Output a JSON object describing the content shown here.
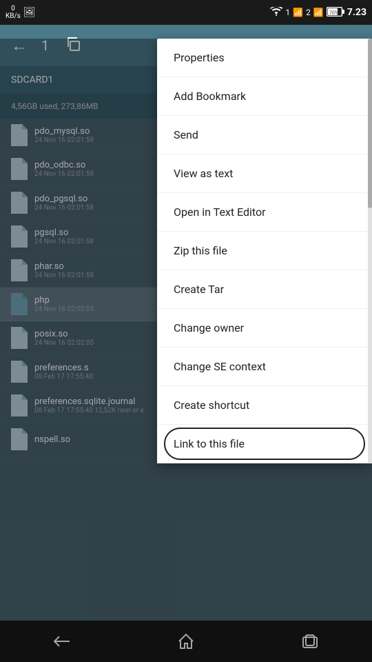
{
  "statusBar": {
    "kb": "0",
    "kb_label": "KB/s",
    "time": "7.23",
    "battery": "70%",
    "network1": "1",
    "network2": "2"
  },
  "toolbar": {
    "back_label": "←",
    "count": "1"
  },
  "breadcrumb": {
    "path": "SDCARD1"
  },
  "usage": {
    "text": "4,56GB used, 273,86MB"
  },
  "files": [
    {
      "name": "pdo_mysql.so",
      "meta": "24 Nov 16 02:01:58"
    },
    {
      "name": "pdo_odbc.so",
      "meta": "24 Nov 16 02:01:58"
    },
    {
      "name": "pdo_pgsql.so",
      "meta": "24 Nov 16 02:01:58"
    },
    {
      "name": "pgsql.so",
      "meta": "24 Nov 16 02:01:58"
    },
    {
      "name": "phar.so",
      "meta": "24 Nov 16 02:01:58"
    },
    {
      "name": "php",
      "meta": "24 Nov 16 02:02:03",
      "selected": true
    },
    {
      "name": "posix.so",
      "meta": "24 Nov 16 02:02:05"
    },
    {
      "name": "preferences.s",
      "meta": "08 Feb 17 17:55:40"
    },
    {
      "name": "preferences.sqlite.journal",
      "meta": "08 Feb 17 17:55:40  12,52K  rwxr-xr-x"
    },
    {
      "name": "nspell.so",
      "meta": ""
    }
  ],
  "menu": {
    "items": [
      {
        "id": "properties",
        "label": "Properties",
        "circled": false
      },
      {
        "id": "add-bookmark",
        "label": "Add Bookmark",
        "circled": false
      },
      {
        "id": "send",
        "label": "Send",
        "circled": false
      },
      {
        "id": "view-as-text",
        "label": "View as text",
        "circled": false
      },
      {
        "id": "open-in-text-editor",
        "label": "Open in Text Editor",
        "circled": false
      },
      {
        "id": "zip-this-file",
        "label": "Zip this file",
        "circled": false
      },
      {
        "id": "create-tar",
        "label": "Create Tar",
        "circled": false
      },
      {
        "id": "change-owner",
        "label": "Change owner",
        "circled": false
      },
      {
        "id": "change-se-context",
        "label": "Change SE context",
        "circled": false
      },
      {
        "id": "create-shortcut",
        "label": "Create shortcut",
        "circled": false
      },
      {
        "id": "link-to-this-file",
        "label": "Link to this file",
        "circled": true
      }
    ]
  },
  "bottomNav": {
    "back": "↩",
    "home": "⌂",
    "recents": "▭"
  }
}
